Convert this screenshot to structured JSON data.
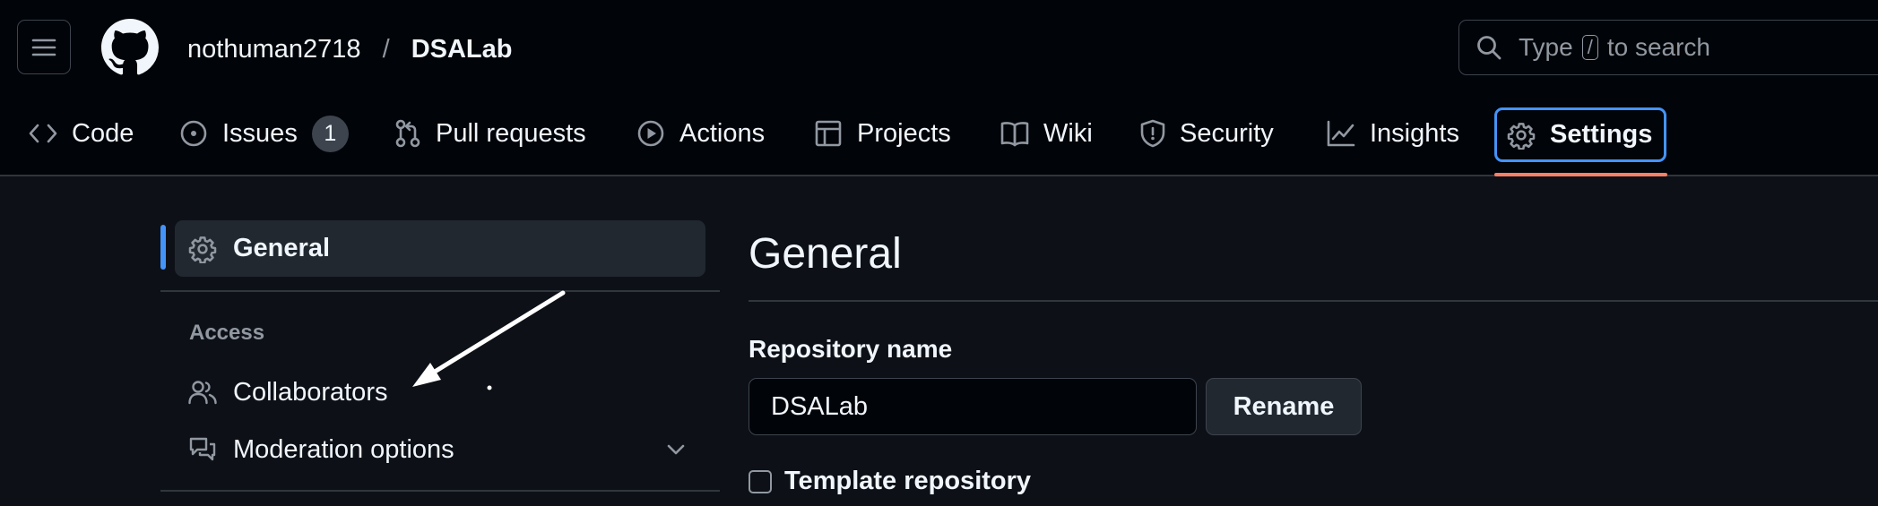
{
  "header": {
    "owner": "nothuman2718",
    "separator": "/",
    "repo": "DSALab",
    "search_prefix": "Type",
    "search_key": "/",
    "search_suffix": "to search"
  },
  "tabs": [
    {
      "label": "Code",
      "icon": "code-icon"
    },
    {
      "label": "Issues",
      "icon": "issue-icon",
      "count": "1"
    },
    {
      "label": "Pull requests",
      "icon": "pull-request-icon"
    },
    {
      "label": "Actions",
      "icon": "play-icon"
    },
    {
      "label": "Projects",
      "icon": "table-icon"
    },
    {
      "label": "Wiki",
      "icon": "book-icon"
    },
    {
      "label": "Security",
      "icon": "shield-icon"
    },
    {
      "label": "Insights",
      "icon": "graph-icon"
    },
    {
      "label": "Settings",
      "icon": "gear-icon",
      "selected": true
    }
  ],
  "sidebar": {
    "general": "General",
    "access_heading": "Access",
    "items": [
      {
        "label": "Collaborators",
        "icon": "people-icon"
      },
      {
        "label": "Moderation options",
        "icon": "comment-discussion-icon"
      }
    ]
  },
  "main": {
    "title": "General",
    "repo_name_label": "Repository name",
    "repo_name_value": "DSALab",
    "rename_button": "Rename",
    "template_label": "Template repository"
  },
  "colors": {
    "accent": "#4493f8",
    "selected_underline": "#f78166",
    "background": "#0d1117",
    "header_background": "#010409"
  }
}
